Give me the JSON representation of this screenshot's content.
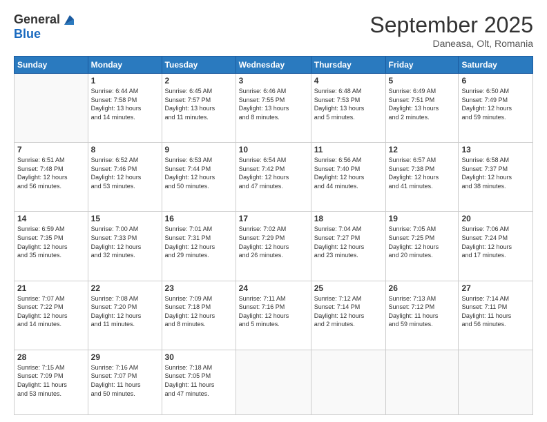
{
  "header": {
    "logo_line1": "General",
    "logo_line2": "Blue",
    "month_year": "September 2025",
    "location": "Daneasa, Olt, Romania"
  },
  "days_of_week": [
    "Sunday",
    "Monday",
    "Tuesday",
    "Wednesday",
    "Thursday",
    "Friday",
    "Saturday"
  ],
  "weeks": [
    [
      {
        "day": "",
        "info": ""
      },
      {
        "day": "1",
        "info": "Sunrise: 6:44 AM\nSunset: 7:58 PM\nDaylight: 13 hours\nand 14 minutes."
      },
      {
        "day": "2",
        "info": "Sunrise: 6:45 AM\nSunset: 7:57 PM\nDaylight: 13 hours\nand 11 minutes."
      },
      {
        "day": "3",
        "info": "Sunrise: 6:46 AM\nSunset: 7:55 PM\nDaylight: 13 hours\nand 8 minutes."
      },
      {
        "day": "4",
        "info": "Sunrise: 6:48 AM\nSunset: 7:53 PM\nDaylight: 13 hours\nand 5 minutes."
      },
      {
        "day": "5",
        "info": "Sunrise: 6:49 AM\nSunset: 7:51 PM\nDaylight: 13 hours\nand 2 minutes."
      },
      {
        "day": "6",
        "info": "Sunrise: 6:50 AM\nSunset: 7:49 PM\nDaylight: 12 hours\nand 59 minutes."
      }
    ],
    [
      {
        "day": "7",
        "info": "Sunrise: 6:51 AM\nSunset: 7:48 PM\nDaylight: 12 hours\nand 56 minutes."
      },
      {
        "day": "8",
        "info": "Sunrise: 6:52 AM\nSunset: 7:46 PM\nDaylight: 12 hours\nand 53 minutes."
      },
      {
        "day": "9",
        "info": "Sunrise: 6:53 AM\nSunset: 7:44 PM\nDaylight: 12 hours\nand 50 minutes."
      },
      {
        "day": "10",
        "info": "Sunrise: 6:54 AM\nSunset: 7:42 PM\nDaylight: 12 hours\nand 47 minutes."
      },
      {
        "day": "11",
        "info": "Sunrise: 6:56 AM\nSunset: 7:40 PM\nDaylight: 12 hours\nand 44 minutes."
      },
      {
        "day": "12",
        "info": "Sunrise: 6:57 AM\nSunset: 7:38 PM\nDaylight: 12 hours\nand 41 minutes."
      },
      {
        "day": "13",
        "info": "Sunrise: 6:58 AM\nSunset: 7:37 PM\nDaylight: 12 hours\nand 38 minutes."
      }
    ],
    [
      {
        "day": "14",
        "info": "Sunrise: 6:59 AM\nSunset: 7:35 PM\nDaylight: 12 hours\nand 35 minutes."
      },
      {
        "day": "15",
        "info": "Sunrise: 7:00 AM\nSunset: 7:33 PM\nDaylight: 12 hours\nand 32 minutes."
      },
      {
        "day": "16",
        "info": "Sunrise: 7:01 AM\nSunset: 7:31 PM\nDaylight: 12 hours\nand 29 minutes."
      },
      {
        "day": "17",
        "info": "Sunrise: 7:02 AM\nSunset: 7:29 PM\nDaylight: 12 hours\nand 26 minutes."
      },
      {
        "day": "18",
        "info": "Sunrise: 7:04 AM\nSunset: 7:27 PM\nDaylight: 12 hours\nand 23 minutes."
      },
      {
        "day": "19",
        "info": "Sunrise: 7:05 AM\nSunset: 7:25 PM\nDaylight: 12 hours\nand 20 minutes."
      },
      {
        "day": "20",
        "info": "Sunrise: 7:06 AM\nSunset: 7:24 PM\nDaylight: 12 hours\nand 17 minutes."
      }
    ],
    [
      {
        "day": "21",
        "info": "Sunrise: 7:07 AM\nSunset: 7:22 PM\nDaylight: 12 hours\nand 14 minutes."
      },
      {
        "day": "22",
        "info": "Sunrise: 7:08 AM\nSunset: 7:20 PM\nDaylight: 12 hours\nand 11 minutes."
      },
      {
        "day": "23",
        "info": "Sunrise: 7:09 AM\nSunset: 7:18 PM\nDaylight: 12 hours\nand 8 minutes."
      },
      {
        "day": "24",
        "info": "Sunrise: 7:11 AM\nSunset: 7:16 PM\nDaylight: 12 hours\nand 5 minutes."
      },
      {
        "day": "25",
        "info": "Sunrise: 7:12 AM\nSunset: 7:14 PM\nDaylight: 12 hours\nand 2 minutes."
      },
      {
        "day": "26",
        "info": "Sunrise: 7:13 AM\nSunset: 7:12 PM\nDaylight: 11 hours\nand 59 minutes."
      },
      {
        "day": "27",
        "info": "Sunrise: 7:14 AM\nSunset: 7:11 PM\nDaylight: 11 hours\nand 56 minutes."
      }
    ],
    [
      {
        "day": "28",
        "info": "Sunrise: 7:15 AM\nSunset: 7:09 PM\nDaylight: 11 hours\nand 53 minutes."
      },
      {
        "day": "29",
        "info": "Sunrise: 7:16 AM\nSunset: 7:07 PM\nDaylight: 11 hours\nand 50 minutes."
      },
      {
        "day": "30",
        "info": "Sunrise: 7:18 AM\nSunset: 7:05 PM\nDaylight: 11 hours\nand 47 minutes."
      },
      {
        "day": "",
        "info": ""
      },
      {
        "day": "",
        "info": ""
      },
      {
        "day": "",
        "info": ""
      },
      {
        "day": "",
        "info": ""
      }
    ]
  ]
}
